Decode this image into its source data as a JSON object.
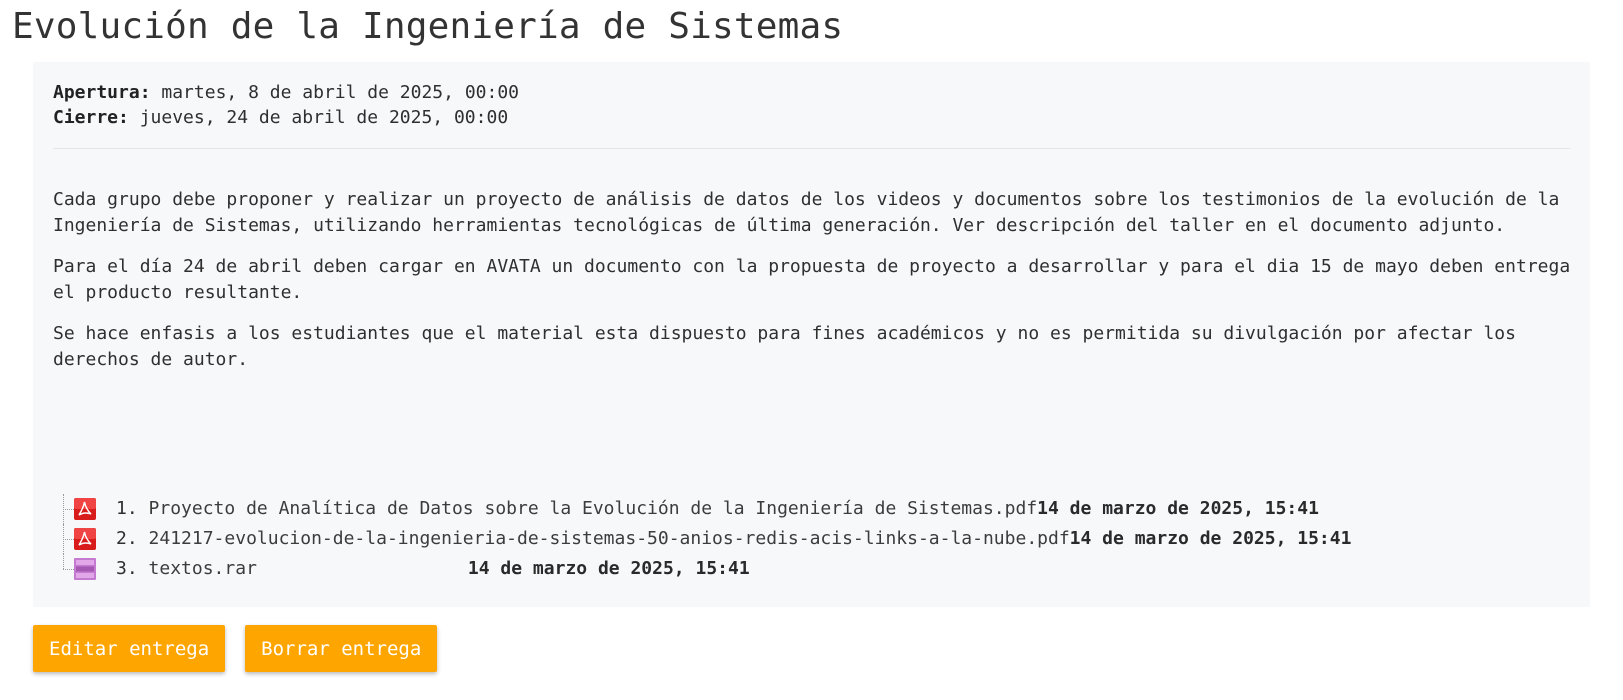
{
  "page": {
    "title": "Evolución de la Ingeniería de Sistemas"
  },
  "dates": {
    "open_label": "Apertura:",
    "open_value": " martes, 8 de abril de 2025, 00:00",
    "close_label": "Cierre:",
    "close_value": " jueves, 24 de abril de 2025, 00:00"
  },
  "intro": {
    "paragraphs": [
      "Cada grupo debe proponer y realizar un proyecto de análisis de datos de los videos y documentos sobre los testimonios de la evolución de la Ingeniería de Sistemas, utilizando herramientas tecnológicas de última generación. Ver descripción del taller en el documento adjunto.",
      "Para el día 24 de abril deben cargar en AVATA un documento con la propuesta de proyecto a desarrollar y para el dia 15 de mayo deben entrega el producto resultante.",
      "Se hace enfasis a los estudiantes que el material esta dispuesto para fines académicos y no es permitida su divulgación por afectar los derechos de autor."
    ]
  },
  "files": [
    {
      "number": "1.",
      "name": "Proyecto de Analítica de Datos sobre la Evolución de la Ingeniería de Sistemas.pdf",
      "date": "14 de marzo de 2025, 15:41",
      "icon": "pdf-icon"
    },
    {
      "number": "2.",
      "name": "241217-evolucion-de-la-ingenieria-de-sistemas-50-anios-redis-acis-links-a-la-nube.pdf",
      "date": "14 de marzo de 2025, 15:41",
      "icon": "pdf-icon"
    },
    {
      "number": "3.",
      "name": "textos.rar",
      "date": "14 de marzo de 2025, 15:41",
      "icon": "archive-icon"
    }
  ],
  "actions": {
    "edit_label": "Editar entrega",
    "delete_label": "Borrar entrega"
  },
  "colors": {
    "accent": "#ffa500",
    "pdf": "#e02020",
    "archive": "#b86bc4"
  }
}
